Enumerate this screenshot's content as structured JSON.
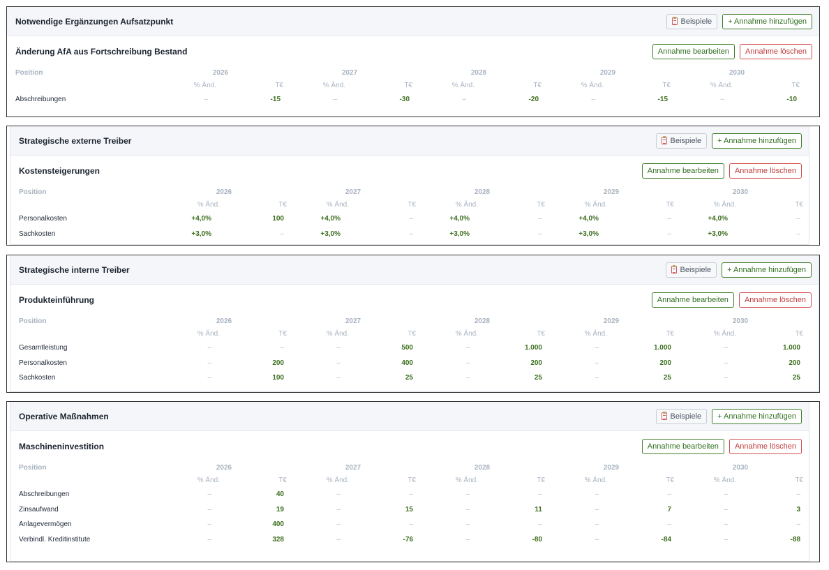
{
  "labels": {
    "examples_btn": "Beispiele",
    "add_btn": "+ Annahme hinzufügen",
    "edit_btn": "Annahme bearbeiten",
    "delete_btn": "Annahme löschen",
    "position": "Position",
    "pct": "% Änd.",
    "te": "T€"
  },
  "years": [
    "2026",
    "2027",
    "2028",
    "2029",
    "2030"
  ],
  "sections": [
    {
      "title": "Notwendige Ergänzungen Aufsatzpunkt",
      "assumption": "Änderung AfA aus Fortschreibung Bestand",
      "rows": [
        {
          "label": "Abschreibungen",
          "values": [
            "–",
            "-15",
            "–",
            "-30",
            "–",
            "-20",
            "–",
            "-15",
            "–",
            "-10"
          ]
        }
      ]
    },
    {
      "title": "Strategische externe Treiber",
      "assumption": "Kostensteigerungen",
      "rows": [
        {
          "label": "Personalkosten",
          "values": [
            "+4,0%",
            "100",
            "+4,0%",
            "–",
            "+4,0%",
            "–",
            "+4,0%",
            "–",
            "+4,0%",
            "–"
          ]
        },
        {
          "label": "Sachkosten",
          "values": [
            "+3,0%",
            "–",
            "+3,0%",
            "–",
            "+3,0%",
            "–",
            "+3,0%",
            "–",
            "+3,0%",
            "–"
          ]
        }
      ]
    },
    {
      "title": "Strategische interne Treiber",
      "assumption": "Produkteinführung",
      "rows": [
        {
          "label": "Gesamtleistung",
          "values": [
            "–",
            "–",
            "–",
            "500",
            "–",
            "1.000",
            "–",
            "1.000",
            "–",
            "1.000"
          ]
        },
        {
          "label": "Personalkosten",
          "values": [
            "–",
            "200",
            "–",
            "400",
            "–",
            "200",
            "–",
            "200",
            "–",
            "200"
          ]
        },
        {
          "label": "Sachkosten",
          "values": [
            "–",
            "100",
            "–",
            "25",
            "–",
            "25",
            "–",
            "25",
            "–",
            "25"
          ]
        }
      ]
    },
    {
      "title": "Operative Maßnahmen",
      "assumption": "Maschineninvestition",
      "rows": [
        {
          "label": "Abschreibungen",
          "values": [
            "–",
            "40",
            "–",
            "–",
            "–",
            "–",
            "–",
            "–",
            "–",
            "–"
          ]
        },
        {
          "label": "Zinsaufwand",
          "values": [
            "–",
            "19",
            "–",
            "15",
            "–",
            "11",
            "–",
            "7",
            "–",
            "3"
          ]
        },
        {
          "label": "Anlagevermögen",
          "values": [
            "–",
            "400",
            "–",
            "–",
            "–",
            "–",
            "–",
            "–",
            "–",
            "–"
          ]
        },
        {
          "label": "Verbindl. Kreditinstitute",
          "values": [
            "–",
            "328",
            "–",
            "-76",
            "–",
            "-80",
            "–",
            "-84",
            "–",
            "-88"
          ]
        }
      ]
    }
  ]
}
